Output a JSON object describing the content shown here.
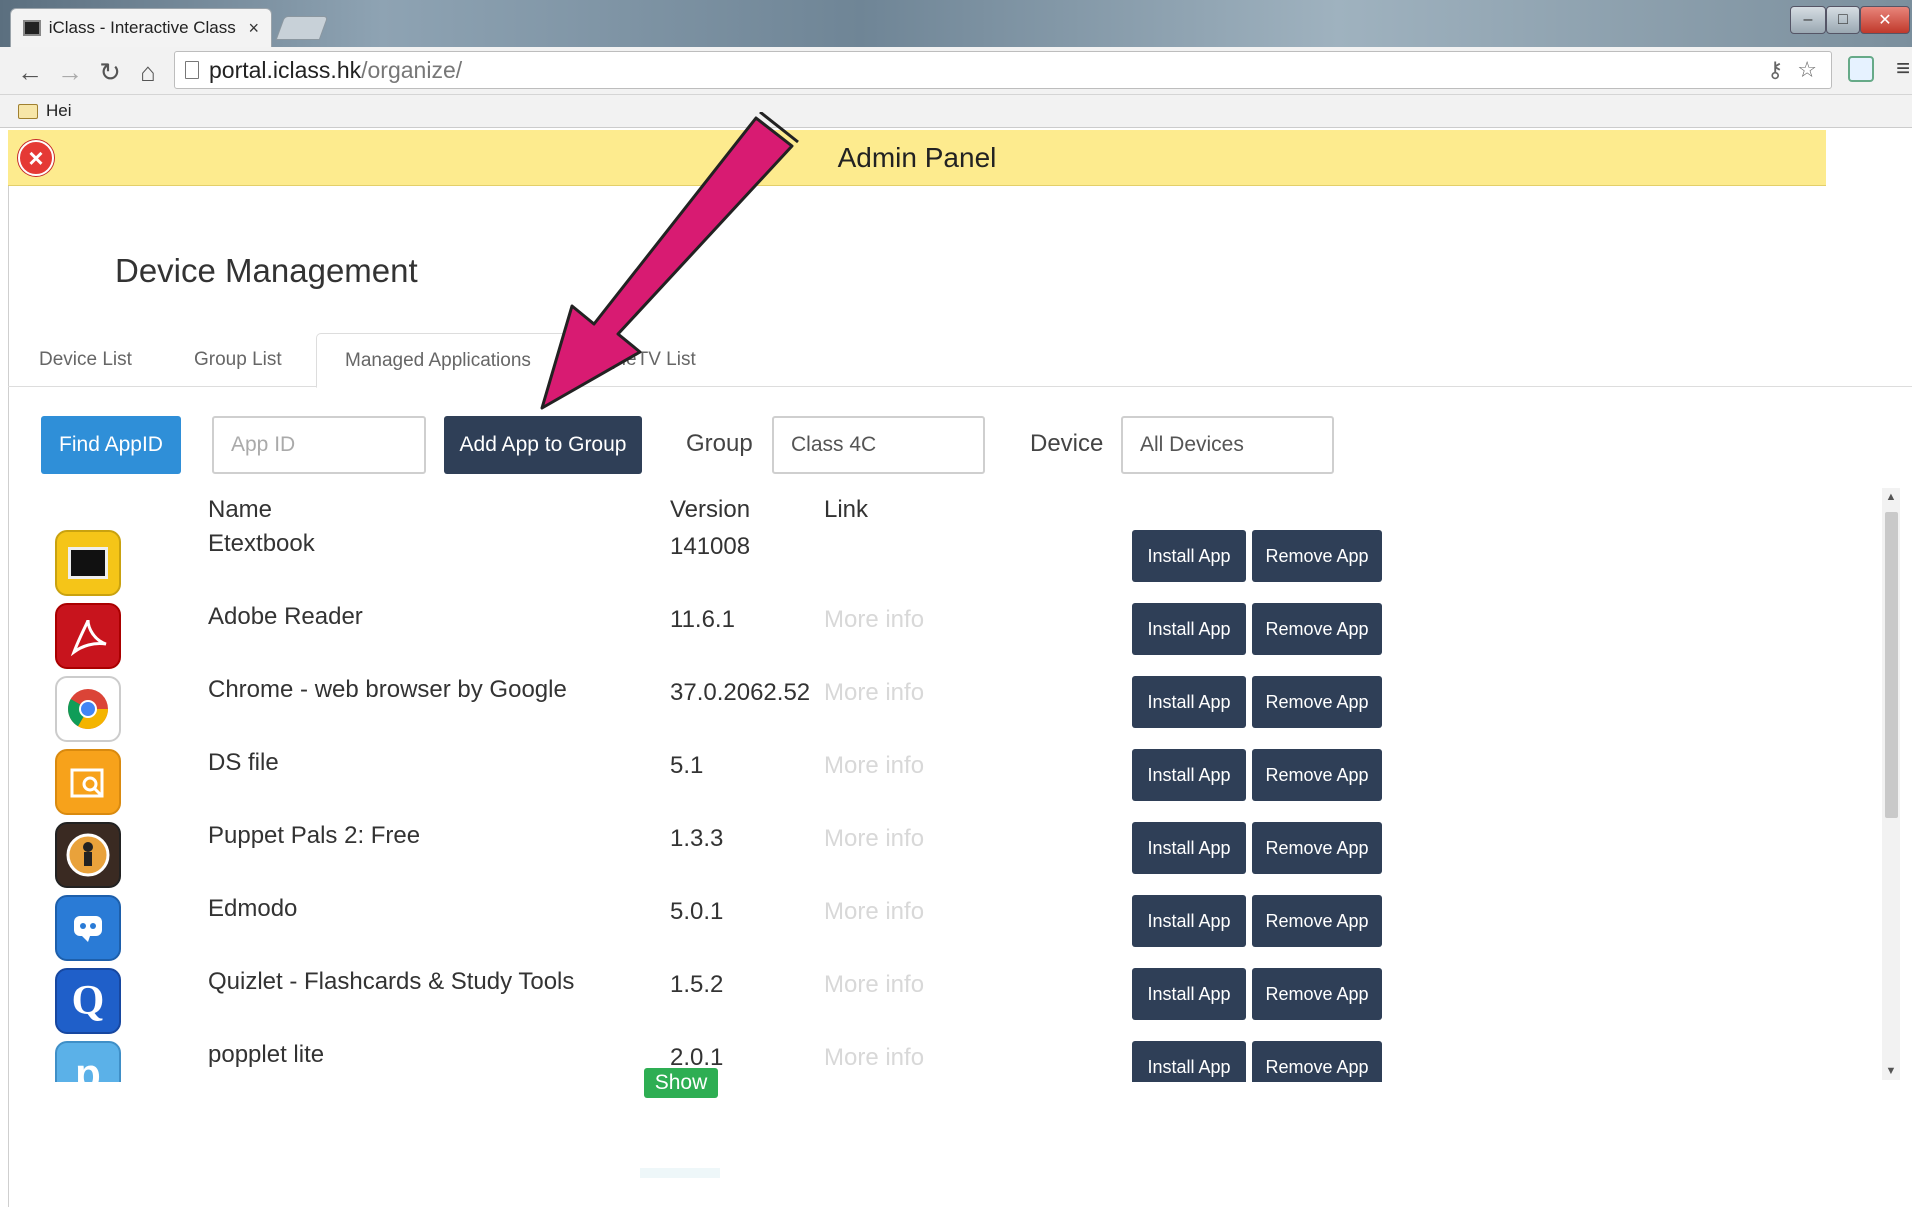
{
  "browser": {
    "tab_title": "iClass - Interactive Class",
    "tab_close": "×",
    "url_host": "portal.iclass.hk",
    "url_path": "/organize/",
    "bookmark_label": "Hei",
    "icons": [
      "back-icon",
      "forward-icon",
      "reload-icon",
      "home-icon",
      "key-icon",
      "star-icon",
      "extension-icon",
      "menu-icon"
    ]
  },
  "banner": {
    "title": "Admin Panel",
    "close_glyph": "×"
  },
  "section_title": "Device Management",
  "tabs": [
    {
      "label": "Device List"
    },
    {
      "label": "Group List"
    },
    {
      "label": "Managed Applications"
    },
    {
      "label": "AppleTV List"
    }
  ],
  "controls": {
    "find_appid": "Find AppID",
    "appid_placeholder": "App ID",
    "add_app_to_group": "Add App to Group",
    "group_label": "Group",
    "group_value": "Class 4C",
    "device_label": "Device",
    "device_value": "All Devices"
  },
  "table": {
    "headers": {
      "name": "Name",
      "version": "Version",
      "link": "Link"
    },
    "install_label": "Install App",
    "remove_label": "Remove App",
    "rows": [
      {
        "name": "Etextbook",
        "version": "141008",
        "link": ""
      },
      {
        "name": "Adobe Reader",
        "version": "11.6.1",
        "link": "More info"
      },
      {
        "name": "Chrome - web browser by Google",
        "version": "37.0.2062.52",
        "link": "More info"
      },
      {
        "name": "DS file",
        "version": "5.1",
        "link": "More info"
      },
      {
        "name": "Puppet Pals 2: Free",
        "version": "1.3.3",
        "link": "More info"
      },
      {
        "name": "Edmodo",
        "version": "5.0.1",
        "link": "More info"
      },
      {
        "name": "Quizlet - Flashcards & Study Tools",
        "version": "1.5.2",
        "link": "More info"
      },
      {
        "name": "popplet lite",
        "version": "2.0.1",
        "link": "More info"
      }
    ]
  },
  "show_badge": "Show",
  "colors": {
    "banner_bg": "#fdeb8e",
    "primary_blue": "#2f8fd8",
    "dark_button": "#2f3f57",
    "annotation_arrow": "#d81b72",
    "show_green": "#2eae53"
  }
}
